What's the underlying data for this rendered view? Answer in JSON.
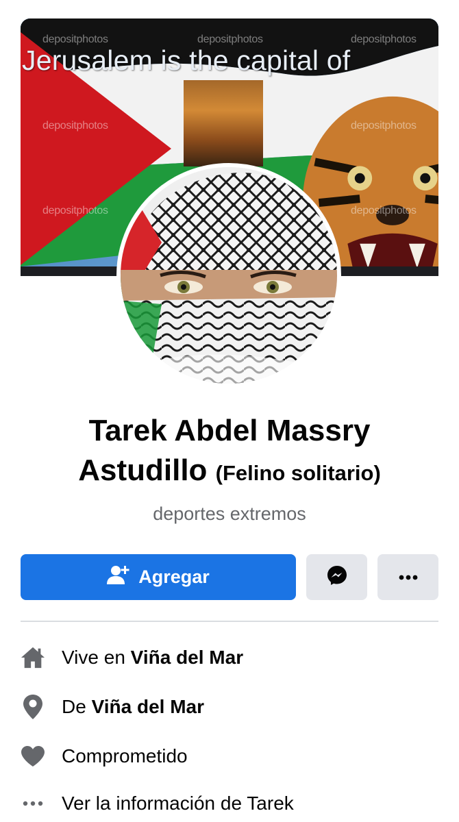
{
  "cover": {
    "caption": "Jerusalem is the capital of",
    "watermark": "depositphotos"
  },
  "profile": {
    "name_line1": "Tarek Abdel Massry",
    "name_line2": "Astudillo",
    "nickname": "(Felino solitario)",
    "bio": "deportes extremos"
  },
  "actions": {
    "add_label": "Agregar"
  },
  "info": {
    "lives_prefix": "Vive en",
    "lives_city": "Viña del Mar",
    "from_prefix": "De",
    "from_city": "Viña del Mar",
    "relationship": "Comprometido",
    "see_more": "Ver la información de Tarek"
  },
  "icons": {
    "home": "home-icon",
    "location": "location-pin-icon",
    "relationship": "heart-icon",
    "more": "ellipsis-icon",
    "add_friend": "add-friend-icon",
    "messenger": "messenger-icon"
  },
  "colors": {
    "primary": "#1b74e4",
    "secondary_button": "#e4e6eb",
    "muted_text": "#65676b",
    "icon_gray": "#65676b"
  }
}
